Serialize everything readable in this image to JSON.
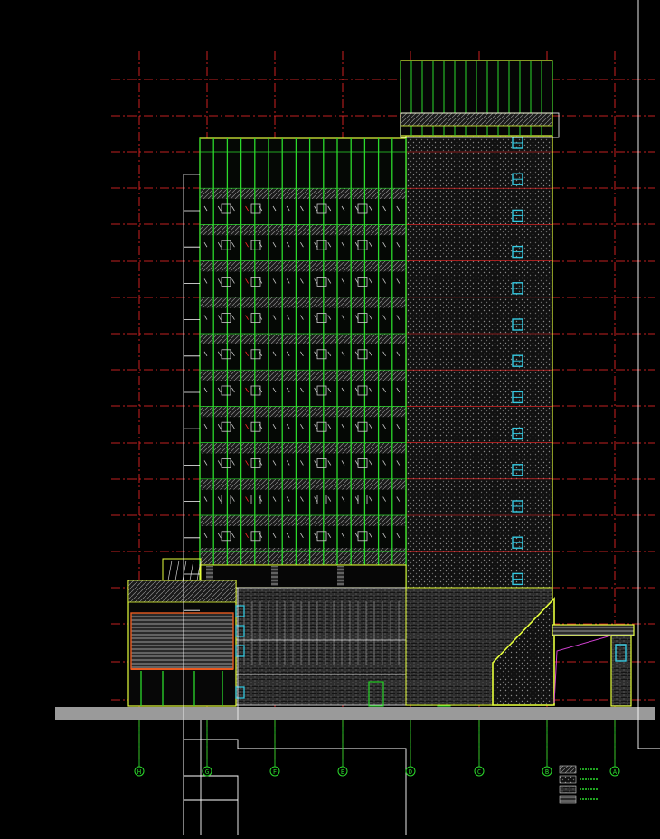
{
  "drawing": {
    "type": "building-elevation-cad",
    "colors": {
      "background": "#000000",
      "axis_line": "#ff2a2a",
      "outline": "#e6ff3c",
      "mullion": "#2bd92b",
      "window": "#35c8e0",
      "hatch": "#8a8a8a",
      "ground": "#9a9a9a",
      "frame": "#ffffff",
      "magenta": "#d040d0"
    },
    "grid_axes": [
      {
        "label": "H"
      },
      {
        "label": "G"
      },
      {
        "label": "F"
      },
      {
        "label": "E"
      },
      {
        "label": "D"
      },
      {
        "label": "C"
      },
      {
        "label": "B"
      },
      {
        "label": "A"
      }
    ],
    "legend": [
      {
        "label": ""
      },
      {
        "label": ""
      },
      {
        "label": ""
      },
      {
        "label": ""
      }
    ]
  }
}
